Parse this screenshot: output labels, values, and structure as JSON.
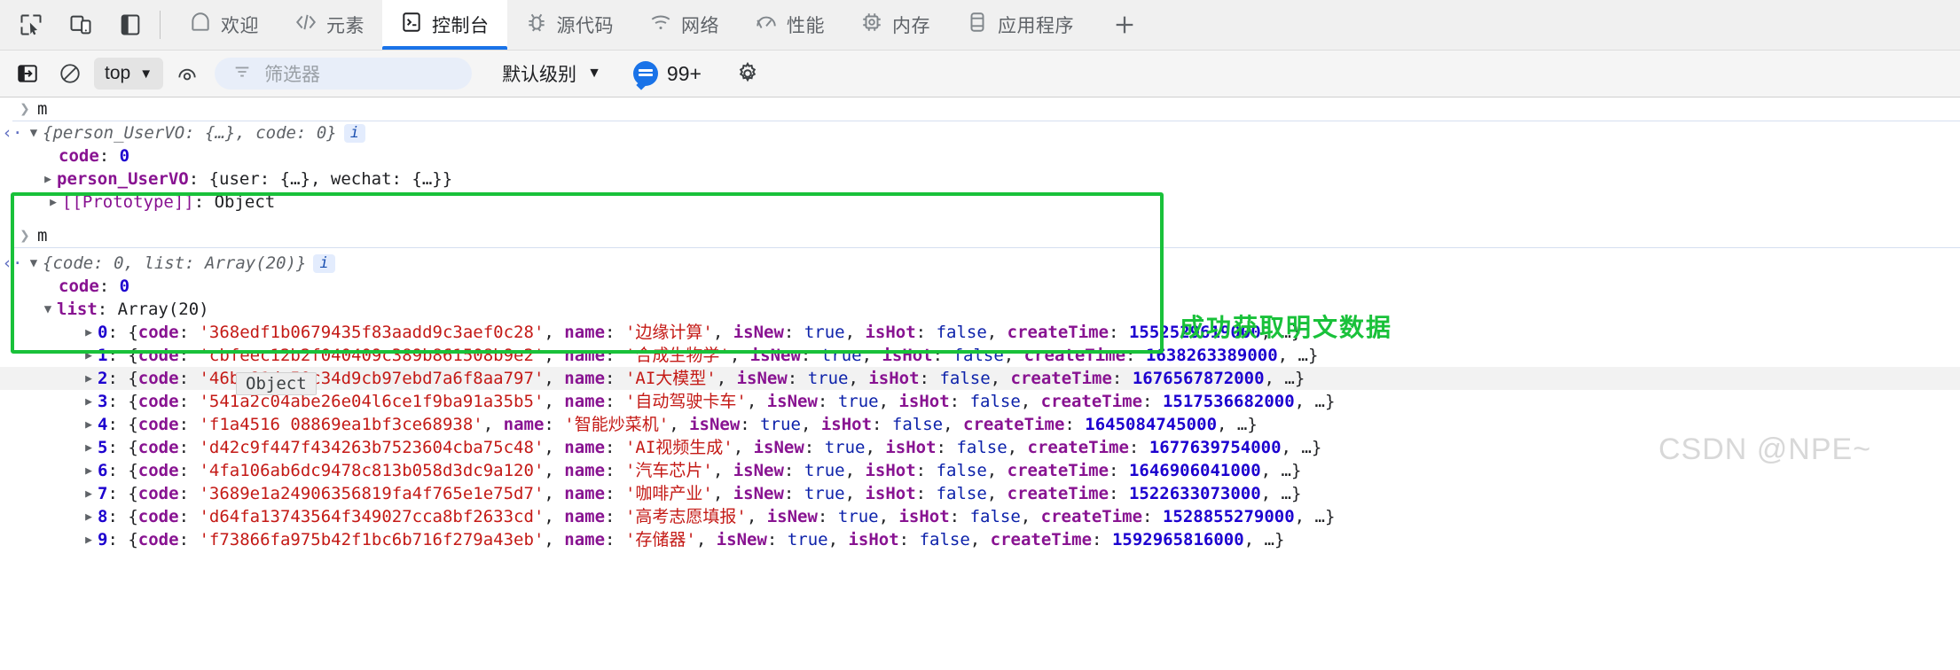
{
  "window": {
    "left_icons": [
      "inspect-cursor-icon",
      "device-toolbar-icon",
      "dock-side-icon"
    ],
    "tabs": [
      {
        "label": "欢迎",
        "icon": "home-icon",
        "active": false
      },
      {
        "label": "元素",
        "icon": "code-brackets-icon",
        "active": false
      },
      {
        "label": "控制台",
        "icon": "console-terminal-icon",
        "active": true
      },
      {
        "label": "源代码",
        "icon": "bug-icon",
        "active": false
      },
      {
        "label": "网络",
        "icon": "wifi-icon",
        "active": false
      },
      {
        "label": "性能",
        "icon": "performance-icon",
        "active": false
      },
      {
        "label": "内存",
        "icon": "memory-chip-icon",
        "active": false
      },
      {
        "label": "应用程序",
        "icon": "application-icon",
        "active": false
      }
    ],
    "add_tab_label": "+"
  },
  "toolbar": {
    "clear_console_icon": "clear-console-icon",
    "no_entry_icon": "no-entry-icon",
    "context_selector": "top",
    "context_caret": "▼",
    "eye_icon": "live-expression-eye-icon",
    "filter_icon": "filter-lines-icon",
    "filter_placeholder": "筛选器",
    "level_label": "默认级别",
    "level_caret": "▼",
    "issues_count": "99+",
    "issues_icon": "issues-bubble-icon",
    "settings_icon": "gear-icon"
  },
  "console": {
    "blocks": [
      {
        "prompt": "m",
        "result_preview": "{person_UserVO: {…}, code: 0}",
        "info_badge": "i",
        "props": [
          {
            "indent": 2,
            "arrow": "",
            "key": "code",
            "sep": ": ",
            "value": "0",
            "vtype": "num"
          },
          {
            "indent": 2,
            "arrow": "▶",
            "key": "person_UserVO",
            "sep": ": ",
            "value": "{user: {…}, wechat: {…}}",
            "vtype": "plain"
          },
          {
            "indent": 2,
            "arrow": "▶",
            "key": "[[Prototype]]",
            "sep": ": ",
            "value": "Object",
            "vtype": "plain"
          }
        ]
      },
      {
        "prompt": "m",
        "result_preview": "{code: 0, list: Array(20)}",
        "info_badge": "i",
        "props": [
          {
            "indent": 2,
            "arrow": "",
            "key": "code",
            "sep": ": ",
            "value": "0",
            "vtype": "num"
          },
          {
            "indent": 2,
            "arrow": "▼",
            "key": "list",
            "sep": ": ",
            "value": "Array(20)",
            "vtype": "plain"
          }
        ]
      }
    ],
    "list_items": [
      {
        "index": "0",
        "code": "368edf1b0679435f83aadd9c3aef0c28",
        "name": "边缘计算",
        "isNew": "true",
        "isHot": "false",
        "createTime": "1552529619000"
      },
      {
        "index": "1",
        "code": "cbfeec12b2f040409c389b861508b9e2",
        "name": "合成生物学",
        "isNew": "true",
        "isHot": "false",
        "createTime": "1638263389000"
      },
      {
        "index": "2",
        "code": "46bc81de50c34d9cb97ebd7a6f8aa797",
        "name": "AI大模型",
        "isNew": "true",
        "isHot": "false",
        "createTime": "1676567872000"
      },
      {
        "index": "3",
        "code": "541a2c04abe26e04l6ce1f9ba91a35b5",
        "name": "自动驾驶卡车",
        "isNew": "true",
        "isHot": "false",
        "createTime": "1517536682000"
      },
      {
        "index": "4",
        "code": "f1a4516       08869ea1bf3ce68938",
        "name": "智能炒菜机",
        "isNew": "true",
        "isHot": "false",
        "createTime": "1645084745000"
      },
      {
        "index": "5",
        "code": "d42c9f447f434263b7523604cba75c48",
        "name": "AI视频生成",
        "isNew": "true",
        "isHot": "false",
        "createTime": "1677639754000"
      },
      {
        "index": "6",
        "code": "4fa106ab6dc9478c813b058d3dc9a120",
        "name": "汽车芯片",
        "isNew": "true",
        "isHot": "false",
        "createTime": "1646906041000"
      },
      {
        "index": "7",
        "code": "3689e1a24906356819fa4f765e1e75d7",
        "name": "咖啡产业",
        "isNew": "true",
        "isHot": "false",
        "createTime": "1522633073000"
      },
      {
        "index": "8",
        "code": "d64fa13743564f349027cca8bf2633cd",
        "name": "高考志愿填报",
        "isNew": "true",
        "isHot": "false",
        "createTime": "1528855279000"
      },
      {
        "index": "9",
        "code": "f73866fa975b42f1bc6b716f279a43eb",
        "name": "存储器",
        "isNew": "true",
        "isHot": "false",
        "createTime": "1592965816000"
      }
    ],
    "item_prefix": "{code: ",
    "item_name_key": "name: ",
    "item_isnew_key": "isNew: ",
    "item_ishot_key": "isHot: ",
    "item_createtime_key": "createTime: ",
    "item_suffix": ", …}",
    "object_tooltip": "Object"
  },
  "annotations": {
    "green_note": "成功获取明文数据",
    "watermark": "CSDN @NPE~"
  },
  "colors": {
    "accent_blue": "#1a73e8",
    "annotation_green": "#19c13a",
    "key_purple": "#881391",
    "string_red": "#c41a16",
    "number_blue": "#1c00cf",
    "bool_blue": "#0d22aa"
  }
}
